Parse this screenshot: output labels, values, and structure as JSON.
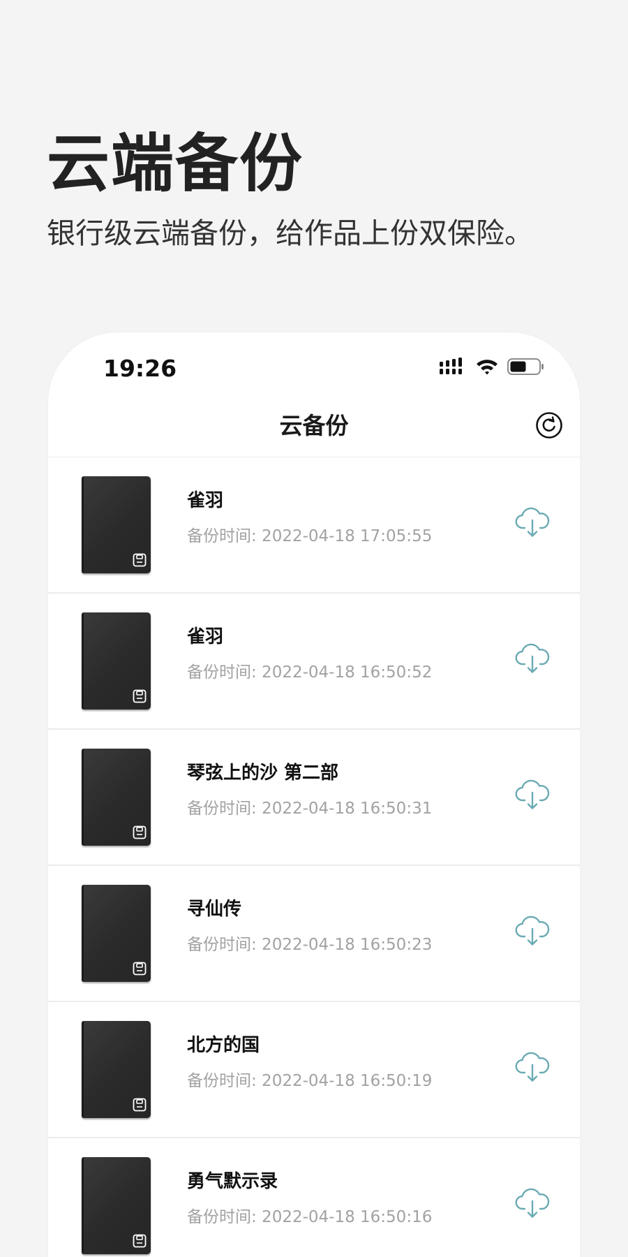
{
  "hero": {
    "title": "云端备份",
    "subtitle": "银行级云端备份，给作品上份双保险。"
  },
  "status_bar": {
    "time": "19:26",
    "icons": [
      "signal-icon",
      "wifi-icon",
      "battery-icon"
    ]
  },
  "nav": {
    "title": "云备份",
    "refresh_icon": "refresh-icon"
  },
  "backups": [
    {
      "title": "雀羽",
      "time": "备份时间: 2022-04-18 17:05:55"
    },
    {
      "title": "雀羽",
      "time": "备份时间: 2022-04-18 16:50:52"
    },
    {
      "title": "琴弦上的沙 第二部",
      "time": "备份时间: 2022-04-18 16:50:31"
    },
    {
      "title": "寻仙传",
      "time": "备份时间: 2022-04-18 16:50:23"
    },
    {
      "title": "北方的国",
      "time": "备份时间: 2022-04-18 16:50:19"
    },
    {
      "title": "勇气默示录",
      "time": "备份时间: 2022-04-18 16:50:16"
    }
  ],
  "colors": {
    "background": "#f4f4f4",
    "accent": "#6aaab3",
    "title_text": "#222222",
    "muted_text": "#a2a2a2"
  }
}
